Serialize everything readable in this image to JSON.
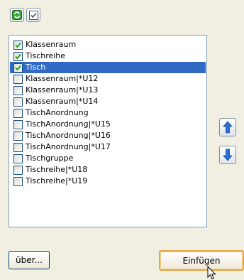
{
  "toolbar": {
    "refresh_icon": "refresh-icon",
    "check_all_icon": "check-all-icon"
  },
  "list": {
    "items": [
      {
        "label": "Klassenraum",
        "checked": true,
        "selected": false
      },
      {
        "label": "Tischreihe",
        "checked": true,
        "selected": false
      },
      {
        "label": "Tisch",
        "checked": true,
        "selected": true
      },
      {
        "label": "Klassenraum|*U12",
        "checked": false,
        "selected": false
      },
      {
        "label": "Klassenraum|*U13",
        "checked": false,
        "selected": false
      },
      {
        "label": "Klassenraum|*U14",
        "checked": false,
        "selected": false
      },
      {
        "label": "TischAnordnung",
        "checked": false,
        "selected": false
      },
      {
        "label": "TischAnordnung|*U15",
        "checked": false,
        "selected": false
      },
      {
        "label": "TischAnordnung|*U16",
        "checked": false,
        "selected": false
      },
      {
        "label": "TischAnordnung|*U17",
        "checked": false,
        "selected": false
      },
      {
        "label": "Tischgruppe",
        "checked": false,
        "selected": false
      },
      {
        "label": "Tischreihe|*U18",
        "checked": false,
        "selected": false
      },
      {
        "label": "Tischreihe|*U19",
        "checked": false,
        "selected": false
      }
    ]
  },
  "side": {
    "up_icon": "arrow-up-icon",
    "down_icon": "arrow-down-icon"
  },
  "buttons": {
    "about_label": "über...",
    "insert_label": "Einfügen"
  },
  "colors": {
    "selection": "#316ac5",
    "check": "#21a121",
    "arrow": "#2b6fd6"
  }
}
